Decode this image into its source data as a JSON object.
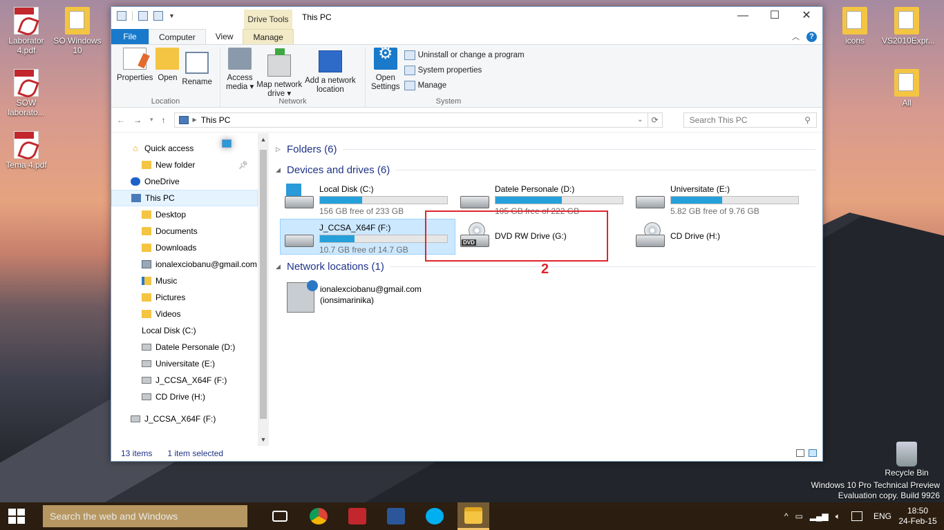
{
  "desktop": {
    "icons_left": [
      {
        "label": "Laborator 4.pdf",
        "icon": "pdf-icon"
      },
      {
        "label": "SOW laborato...",
        "icon": "pdf-icon"
      },
      {
        "label": "Tema 4.pdf",
        "icon": "pdf-icon"
      }
    ],
    "so_windows": {
      "label": "SO Windows 10",
      "icon": "folder-icon"
    },
    "icons_right": [
      {
        "label": "icons",
        "icon": "folder-icon"
      },
      {
        "label": "VS2010Expr...",
        "icon": "folder-icon"
      },
      {
        "label": "All",
        "icon": "folder-icon"
      }
    ],
    "recycle_bin": "Recycle Bin",
    "watermark": {
      "line1": "Windows 10 Pro Technical Preview",
      "line2": "Evaluation copy. Build 9926"
    }
  },
  "window": {
    "title": "This PC",
    "context_tab": "Drive Tools",
    "controls": {
      "minimize": "—",
      "maximize": "☐",
      "close": "✕"
    },
    "tabs": [
      "File",
      "Computer",
      "View",
      "Manage"
    ],
    "active_tab": "Computer",
    "ribbon": {
      "location": {
        "label": "Location",
        "buttons": [
          "Properties",
          "Open",
          "Rename"
        ]
      },
      "network": {
        "label": "Network",
        "access_media": [
          "Access",
          "media ▾"
        ],
        "map_network_drive": [
          "Map network",
          "drive ▾"
        ],
        "add_network_location": [
          "Add a network",
          "location"
        ]
      },
      "system": {
        "label": "System",
        "open_settings": [
          "Open",
          "Settings"
        ],
        "items": [
          "Uninstall or change a program",
          "System properties",
          "Manage"
        ]
      }
    },
    "address": {
      "path": "This PC",
      "search_placeholder": "Search This PC"
    },
    "nav": [
      {
        "label": "Quick access",
        "icon": "star",
        "level": 0
      },
      {
        "label": "New folder",
        "icon": "folder",
        "level": 1,
        "pinned": true
      },
      {
        "label": "OneDrive",
        "icon": "cloud",
        "level": 0
      },
      {
        "label": "This PC",
        "icon": "pc",
        "level": 0,
        "selected": true
      },
      {
        "label": "Desktop",
        "icon": "folder",
        "level": 1
      },
      {
        "label": "Documents",
        "icon": "folder",
        "level": 1
      },
      {
        "label": "Downloads",
        "icon": "folder",
        "level": 1
      },
      {
        "label": "ionalexciobanu@gmail.com",
        "icon": "net",
        "level": 1
      },
      {
        "label": "Music",
        "icon": "music",
        "level": 1
      },
      {
        "label": "Pictures",
        "icon": "folder",
        "level": 1
      },
      {
        "label": "Videos",
        "icon": "folder",
        "level": 1
      },
      {
        "label": "Local Disk (C:)",
        "icon": "win",
        "level": 1
      },
      {
        "label": "Datele Personale (D:)",
        "icon": "drive",
        "level": 1
      },
      {
        "label": "Universitate (E:)",
        "icon": "drive",
        "level": 1
      },
      {
        "label": "J_CCSA_X64F (F:)",
        "icon": "drive",
        "level": 1
      },
      {
        "label": "CD Drive (H:)",
        "icon": "drive",
        "level": 1
      },
      {
        "label": "J_CCSA_X64F (F:)",
        "icon": "drive",
        "level": 0,
        "gap": true
      }
    ],
    "sections": {
      "folders": "Folders (6)",
      "devices": "Devices and drives (6)",
      "network": "Network locations (1)"
    },
    "drives": [
      {
        "name": "Local Disk (C:)",
        "free": "156 GB free of 233 GB",
        "used_fraction": 0.33,
        "icon": "windows-drive-icon"
      },
      {
        "name": "Datele Personale (D:)",
        "free": "105 GB free of 222 GB",
        "used_fraction": 0.52,
        "icon": "hard-drive-icon"
      },
      {
        "name": "Universitate (E:)",
        "free": "5.82 GB free of 9.76 GB",
        "used_fraction": 0.4,
        "icon": "hard-drive-icon"
      },
      {
        "name": "J_CCSA_X64F (F:)",
        "free": "10.7 GB free of 14.7 GB",
        "used_fraction": 0.27,
        "icon": "removable-drive-icon",
        "selected": true
      },
      {
        "name": "DVD RW Drive (G:)",
        "icon": "dvd-drive-icon"
      },
      {
        "name": "CD Drive (H:)",
        "icon": "cd-drive-icon"
      }
    ],
    "annotation": "2",
    "network_location": {
      "line1": "ionalexciobanu@gmail.com",
      "line2": "(ionsimarinika)"
    },
    "status": {
      "count": "13 items",
      "selected": "1 item selected"
    }
  },
  "taskbar": {
    "search_placeholder": "Search the web and Windows",
    "apps": [
      "task-view-icon",
      "chrome-icon",
      "acrobat-icon",
      "word-icon",
      "skype-icon",
      "file-explorer-icon"
    ],
    "language": "ENG",
    "time": "18:50",
    "date": "24-Feb-15"
  },
  "colors": {
    "accent": "#1979ca",
    "selection": "#cce8ff",
    "bar_fill": "#26a0da",
    "annotation": "#e0242c"
  }
}
